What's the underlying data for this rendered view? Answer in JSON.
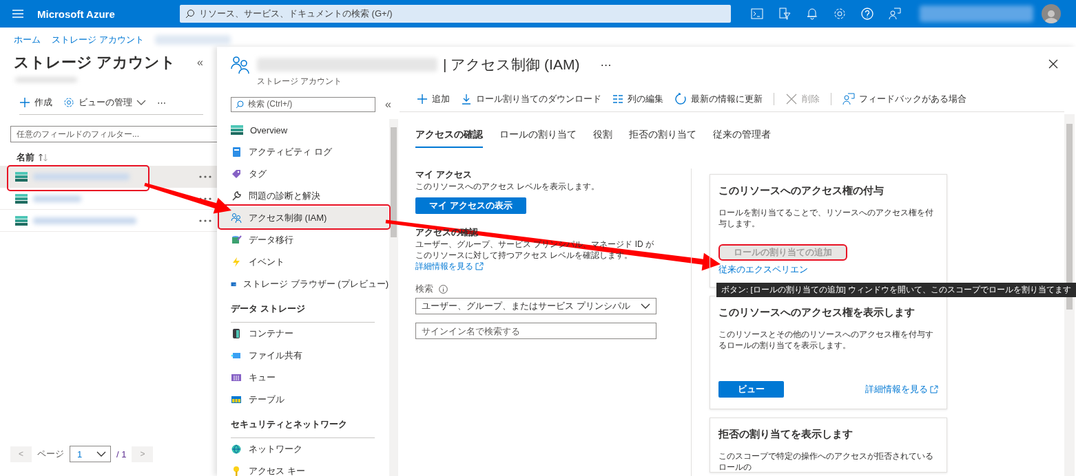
{
  "topbar": {
    "brand": "Microsoft Azure",
    "search": {
      "placeholder": "リソース、サービス、ドキュメントの検索 (G+/)"
    }
  },
  "breadcrumb": [
    "ホーム",
    "ストレージ アカウント"
  ],
  "list_panel": {
    "title": "ストレージ アカウント",
    "collapse": "«",
    "toolbar": [
      {
        "kind": "create",
        "label": "作成"
      },
      {
        "kind": "manage",
        "label": "ビューの管理"
      },
      {
        "kind": "more",
        "label": "⋯"
      }
    ],
    "filter": {
      "placeholder": "任意のフィールドのフィルター..."
    },
    "column": "名前",
    "rows": [
      {
        "selected": true
      },
      {
        "selected": false
      },
      {
        "selected": false
      }
    ],
    "pagination": {
      "prev": "<",
      "label": "ページ",
      "page": "1",
      "total": "/ 1",
      "next": ">"
    }
  },
  "blade": {
    "title": "| アクセス制御 (IAM)",
    "more": "⋯",
    "subtitle": "ストレージ アカウント"
  },
  "menu": {
    "search": {
      "placeholder": "検索 (Ctrl+/)"
    },
    "collapse": "«",
    "sections": [
      {
        "items": [
          {
            "label": "Overview",
            "selected": false
          },
          {
            "label": "アクティビティ ログ",
            "selected": false
          },
          {
            "label": "タグ",
            "selected": false
          },
          {
            "label": "問題の診断と解決",
            "selected": false
          },
          {
            "label": "アクセス制御 (IAM)",
            "selected": true
          },
          {
            "label": "データ移行",
            "selected": false
          },
          {
            "label": "イベント",
            "selected": false
          },
          {
            "label": "ストレージ ブラウザー (プレビュー)",
            "selected": false
          }
        ]
      },
      {
        "heading": "データ ストレージ",
        "items": [
          {
            "label": "コンテナー",
            "selected": false
          },
          {
            "label": "ファイル共有",
            "selected": false
          },
          {
            "label": "キュー",
            "selected": false
          },
          {
            "label": "テーブル",
            "selected": false
          }
        ]
      },
      {
        "heading": "セキュリティとネットワーク",
        "items": [
          {
            "label": "ネットワーク",
            "selected": false
          },
          {
            "label": "アクセス キー",
            "selected": false
          }
        ]
      }
    ]
  },
  "toolbar": [
    {
      "kind": "add",
      "label": "追加",
      "disabled": false,
      "separator_before": false
    },
    {
      "kind": "download",
      "label": "ロール割り当てのダウンロード",
      "disabled": false,
      "separator_before": false
    },
    {
      "kind": "columns",
      "label": "列の編集",
      "disabled": false,
      "separator_before": false
    },
    {
      "kind": "refresh",
      "label": "最新の情報に更新",
      "disabled": false,
      "separator_before": false
    },
    {
      "kind": "delete",
      "label": "削除",
      "disabled": true,
      "separator_before": true
    },
    {
      "kind": "feedback",
      "label": "フィードバックがある場合",
      "disabled": false,
      "separator_before": true
    }
  ],
  "tabs": [
    {
      "label": "アクセスの確認",
      "selected": true
    },
    {
      "label": "ロールの割り当て",
      "selected": false
    },
    {
      "label": "役割",
      "selected": false
    },
    {
      "label": "拒否の割り当て",
      "selected": false
    },
    {
      "label": "従来の管理者",
      "selected": false
    }
  ],
  "my_access": {
    "title": "マイ アクセス",
    "description": "このリソースへのアクセス レベルを表示します。",
    "button": "マイ アクセスの表示"
  },
  "check_access": {
    "title": "アクセスの確認",
    "description": "ユーザー、グループ、サービス プリンシパル、マネージド ID がこのリソースに対して持つアクセス レベルを確認します。",
    "link": "詳細情報を見る",
    "search_label": "検索",
    "dropdown": "ユーザー、グループ、またはサービス プリンシパル",
    "input": {
      "placeholder": "サインイン名で検索する"
    }
  },
  "cards": [
    {
      "title": "このリソースへのアクセス権の付与",
      "description": "ロールを割り当てることで、リソースへのアクセス権を付与します。",
      "button": {
        "label": "ロールの割り当ての追加",
        "disabled": true
      },
      "link": "従来のエクスペリエン",
      "external": false
    },
    {
      "title": "このリソースへのアクセス権を表示します",
      "description": "このリソースとその他のリソースへのアクセス権を付与するロールの割り当てを表示します。",
      "button": {
        "label": "ビュー",
        "disabled": false
      },
      "link": "詳細情報を見る",
      "external": true
    },
    {
      "title": "拒否の割り当てを表示します",
      "description": "このスコープで特定の操作へのアクセスが拒否されているロールの"
    }
  ],
  "tooltip": "ボタン: [ロールの割り当ての追加] ウィンドウを開いて、このスコープでロールを割り当てます"
}
